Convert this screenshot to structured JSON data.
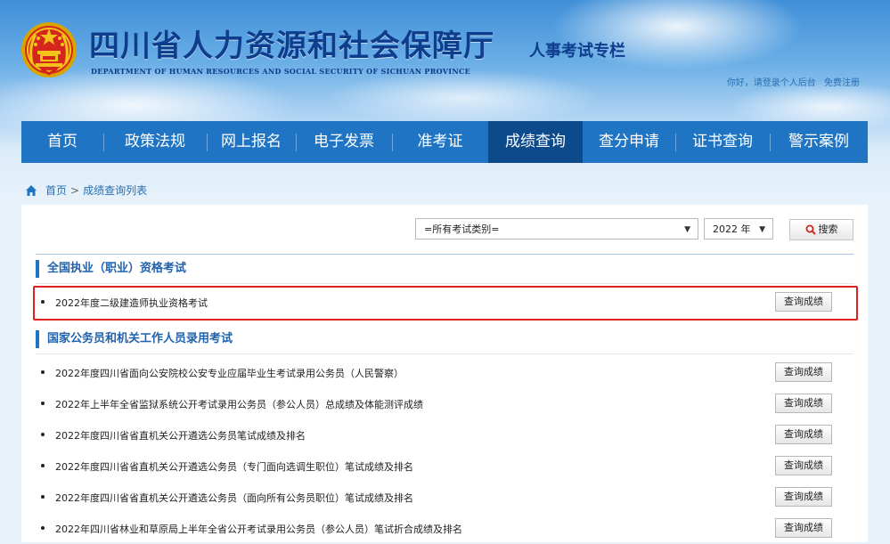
{
  "header": {
    "title": "四川省人力资源和社会保障厅",
    "subtitle": "DEPARTMENT OF HUMAN RESOURCES AND SOCIAL SECURITY OF SICHUAN PROVINCE",
    "column": "人事考试专栏",
    "user_links": {
      "greeting": "你好，请登录个人后台",
      "register": "免费注册"
    }
  },
  "nav": {
    "items": [
      {
        "label": "首页"
      },
      {
        "label": "政策法规"
      },
      {
        "label": "网上报名"
      },
      {
        "label": "电子发票"
      },
      {
        "label": "准考证"
      },
      {
        "label": "成绩查询",
        "active": true
      },
      {
        "label": "查分申请"
      },
      {
        "label": "证书查询"
      },
      {
        "label": "警示案例"
      }
    ]
  },
  "breadcrumb": {
    "home": "首页",
    "separator": ">",
    "current": "成绩查询列表"
  },
  "filters": {
    "category": "=所有考试类别=",
    "year": "2022 年",
    "search_label": "搜索"
  },
  "sections": [
    {
      "title": "全国执业（职业）资格考试",
      "items": [
        {
          "title": "2022年度二级建造师执业资格考试",
          "action": "查询成绩",
          "highlighted": true
        }
      ]
    },
    {
      "title": "国家公务员和机关工作人员录用考试",
      "items": [
        {
          "title": "2022年度四川省面向公安院校公安专业应届毕业生考试录用公务员（人民警察）",
          "action": "查询成绩"
        },
        {
          "title": "2022年上半年全省监狱系统公开考试录用公务员（参公人员）总成绩及体能测评成绩",
          "action": "查询成绩"
        },
        {
          "title": "2022年度四川省省直机关公开遴选公务员笔试成绩及排名",
          "action": "查询成绩"
        },
        {
          "title": "2022年度四川省省直机关公开遴选公务员（专门面向选调生职位）笔试成绩及排名",
          "action": "查询成绩"
        },
        {
          "title": "2022年度四川省省直机关公开遴选公务员（面向所有公务员职位）笔试成绩及排名",
          "action": "查询成绩"
        },
        {
          "title": "2022年四川省林业和草原局上半年全省公开考试录用公务员（参公人员）笔试折合成绩及排名",
          "action": "查询成绩"
        }
      ]
    }
  ],
  "colors": {
    "nav_bg": "#1f75c3",
    "nav_active": "#0d4a8c",
    "title_blue": "#0d3d8c",
    "highlight_red": "#e0211d"
  }
}
